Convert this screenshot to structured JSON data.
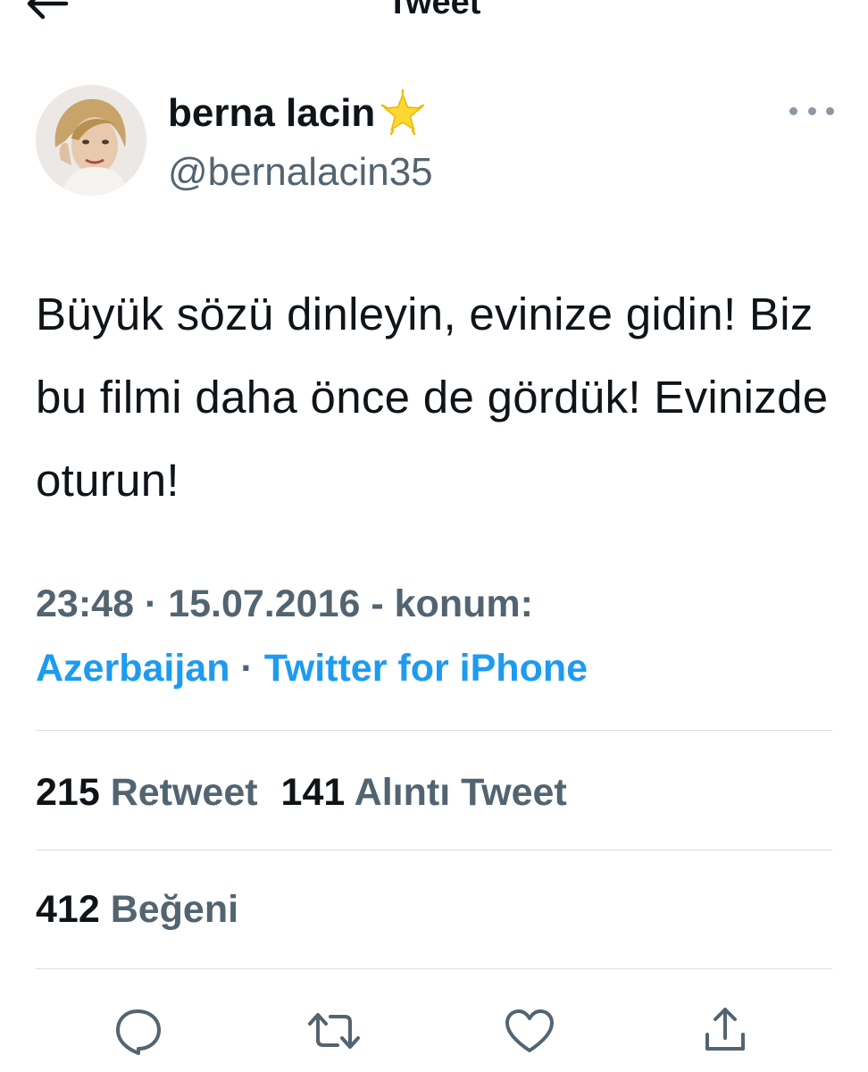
{
  "header": {
    "title": "Tweet",
    "back_icon": "back-arrow-icon"
  },
  "author": {
    "name": "berna lacin",
    "badge_icon": "glowing-star-icon",
    "handle": "@bernalacin35"
  },
  "tweet": {
    "text": "Büyük sözü dinleyin, evinize gidin! Biz bu filmi daha önce de gördük! Evinizde oturun!",
    "time": "23:48",
    "date": "15.07.2016",
    "location_label": "konum:",
    "location": "Azerbaijan",
    "source": "Twitter for iPhone"
  },
  "stats": {
    "retweets": "215",
    "retweets_label": "Retweet",
    "quotes": "141",
    "quotes_label": "Alıntı Tweet",
    "likes": "412",
    "likes_label": "Beğeni"
  },
  "actions": [
    "reply-icon",
    "retweet-icon",
    "like-icon",
    "share-icon"
  ],
  "colors": {
    "accent": "#1d9bf0",
    "secondary_text": "#536471",
    "primary_text": "#0f1419"
  }
}
